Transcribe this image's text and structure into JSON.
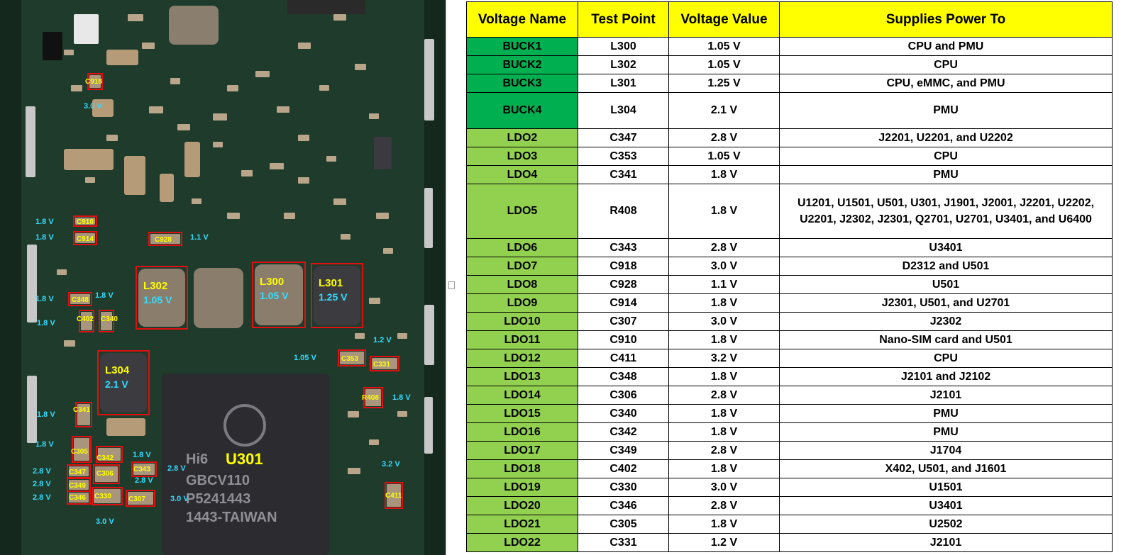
{
  "colors": {
    "pcb": "#1e3b2c",
    "header_bg": "#ffff00",
    "buck_bg": "#00b050",
    "ldo_bg": "#92d050",
    "label_yellow": "#ffff00",
    "label_cyan": "#33ddff",
    "box_red": "#e01010"
  },
  "board": {
    "cpu_label": "U301",
    "chip_text": [
      "Hi6",
      "GBCV110",
      "P5241443",
      "1443-TAIWAN"
    ],
    "inductors": [
      {
        "id": "L302",
        "voltage": "1.05 V"
      },
      {
        "id": "L300",
        "voltage": "1.05 V"
      },
      {
        "id": "L301",
        "voltage": "1.25 V"
      },
      {
        "id": "L304",
        "voltage": "2.1 V"
      }
    ],
    "components": [
      {
        "id": "C918",
        "voltage": "3.0 V"
      },
      {
        "id": "C910",
        "voltage": "1.8 V"
      },
      {
        "id": "C914",
        "voltage": "1.8 V"
      },
      {
        "id": "C928",
        "voltage": "1.1 V"
      },
      {
        "id": "C348",
        "voltage": "1.8 V"
      },
      {
        "id": "C402",
        "voltage": "1.8 V"
      },
      {
        "id": "C340",
        "voltage": "1.8 V"
      },
      {
        "id": "C353",
        "voltage": "1.05 V"
      },
      {
        "id": "C331",
        "voltage": "1.2 V"
      },
      {
        "id": "R408",
        "voltage": "1.8 V"
      },
      {
        "id": "C341",
        "voltage": "1.8 V"
      },
      {
        "id": "C305",
        "voltage": "1.8 V"
      },
      {
        "id": "C342",
        "voltage": "1.8 V"
      },
      {
        "id": "C347",
        "voltage": "2.8 V"
      },
      {
        "id": "C306",
        "voltage": "2.8 V"
      },
      {
        "id": "C343",
        "voltage": "2.8 V"
      },
      {
        "id": "C349",
        "voltage": "2.8 V"
      },
      {
        "id": "C346",
        "voltage": "2.8 V"
      },
      {
        "id": "C330",
        "voltage": "3.0 V"
      },
      {
        "id": "C307",
        "voltage": "3.0 V"
      },
      {
        "id": "C411",
        "voltage": "3.2 V"
      }
    ]
  },
  "table": {
    "headers": [
      "Voltage Name",
      "Test Point",
      "Voltage Value",
      "Supplies Power To"
    ],
    "rows": [
      {
        "name": "BUCK1",
        "tp": "L300",
        "v": "1.05 V",
        "to": "CPU and PMU",
        "kind": "buck"
      },
      {
        "name": "BUCK2",
        "tp": "L302",
        "v": "1.05 V",
        "to": "CPU",
        "kind": "buck"
      },
      {
        "name": "BUCK3",
        "tp": "L301",
        "v": "1.25 V",
        "to": "CPU, eMMC, and PMU",
        "kind": "buck"
      },
      {
        "name": "BUCK4",
        "tp": "L304",
        "v": "2.1 V",
        "to": "PMU",
        "kind": "buck"
      },
      {
        "name": "LDO2",
        "tp": "C347",
        "v": "2.8 V",
        "to": "J2201, U2201, and U2202",
        "kind": "ldo"
      },
      {
        "name": "LDO3",
        "tp": "C353",
        "v": "1.05 V",
        "to": "CPU",
        "kind": "ldo"
      },
      {
        "name": "LDO4",
        "tp": "C341",
        "v": "1.8 V",
        "to": "PMU",
        "kind": "ldo"
      },
      {
        "name": "LDO5",
        "tp": "R408",
        "v": "1.8 V",
        "to": "U1201, U1501, U501, U301, J1901, J2001, J2201, U2202, U2201, J2302, J2301, Q2701, U2701, U3401, and U6400",
        "kind": "ldo"
      },
      {
        "name": "LDO6",
        "tp": "C343",
        "v": "2.8 V",
        "to": "U3401",
        "kind": "ldo"
      },
      {
        "name": "LDO7",
        "tp": "C918",
        "v": "3.0 V",
        "to": "D2312 and U501",
        "kind": "ldo"
      },
      {
        "name": "LDO8",
        "tp": "C928",
        "v": "1.1 V",
        "to": "U501",
        "kind": "ldo"
      },
      {
        "name": "LDO9",
        "tp": "C914",
        "v": "1.8 V",
        "to": "J2301, U501, and U2701",
        "kind": "ldo"
      },
      {
        "name": "LDO10",
        "tp": "C307",
        "v": "3.0 V",
        "to": "J2302",
        "kind": "ldo"
      },
      {
        "name": "LDO11",
        "tp": "C910",
        "v": "1.8 V",
        "to": "Nano-SIM card and U501",
        "kind": "ldo"
      },
      {
        "name": "LDO12",
        "tp": "C411",
        "v": "3.2 V",
        "to": "CPU",
        "kind": "ldo"
      },
      {
        "name": "LDO13",
        "tp": "C348",
        "v": "1.8 V",
        "to": "J2101 and J2102",
        "kind": "ldo"
      },
      {
        "name": "LDO14",
        "tp": "C306",
        "v": "2.8 V",
        "to": "J2101",
        "kind": "ldo"
      },
      {
        "name": "LDO15",
        "tp": "C340",
        "v": "1.8 V",
        "to": "PMU",
        "kind": "ldo"
      },
      {
        "name": "LDO16",
        "tp": "C342",
        "v": "1.8 V",
        "to": "PMU",
        "kind": "ldo"
      },
      {
        "name": "LDO17",
        "tp": "C349",
        "v": "2.8 V",
        "to": "J1704",
        "kind": "ldo"
      },
      {
        "name": "LDO18",
        "tp": "C402",
        "v": "1.8 V",
        "to": "X402, U501, and J1601",
        "kind": "ldo"
      },
      {
        "name": "LDO19",
        "tp": "C330",
        "v": "3.0 V",
        "to": "U1501",
        "kind": "ldo"
      },
      {
        "name": "LDO20",
        "tp": "C346",
        "v": "2.8 V",
        "to": "U3401",
        "kind": "ldo"
      },
      {
        "name": "LDO21",
        "tp": "C305",
        "v": "1.8 V",
        "to": "U2502",
        "kind": "ldo"
      },
      {
        "name": "LDO22",
        "tp": "C331",
        "v": "1.2 V",
        "to": "J2101",
        "kind": "ldo"
      }
    ]
  }
}
